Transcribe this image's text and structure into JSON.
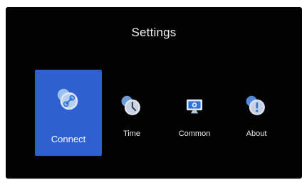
{
  "screen": {
    "title": "Settings"
  },
  "tiles": [
    {
      "label": "Connect",
      "icon": "link-icon",
      "selected": true
    },
    {
      "label": "Time",
      "icon": "clock-icon",
      "selected": false
    },
    {
      "label": "Common",
      "icon": "display-icon",
      "selected": false
    },
    {
      "label": "About",
      "icon": "info-icon",
      "selected": false
    }
  ],
  "colors": {
    "background": "#020202",
    "selected_tile": "#2f60cf",
    "icon_light": "#c9d6ea",
    "icon_blue": "#2b71d8"
  }
}
